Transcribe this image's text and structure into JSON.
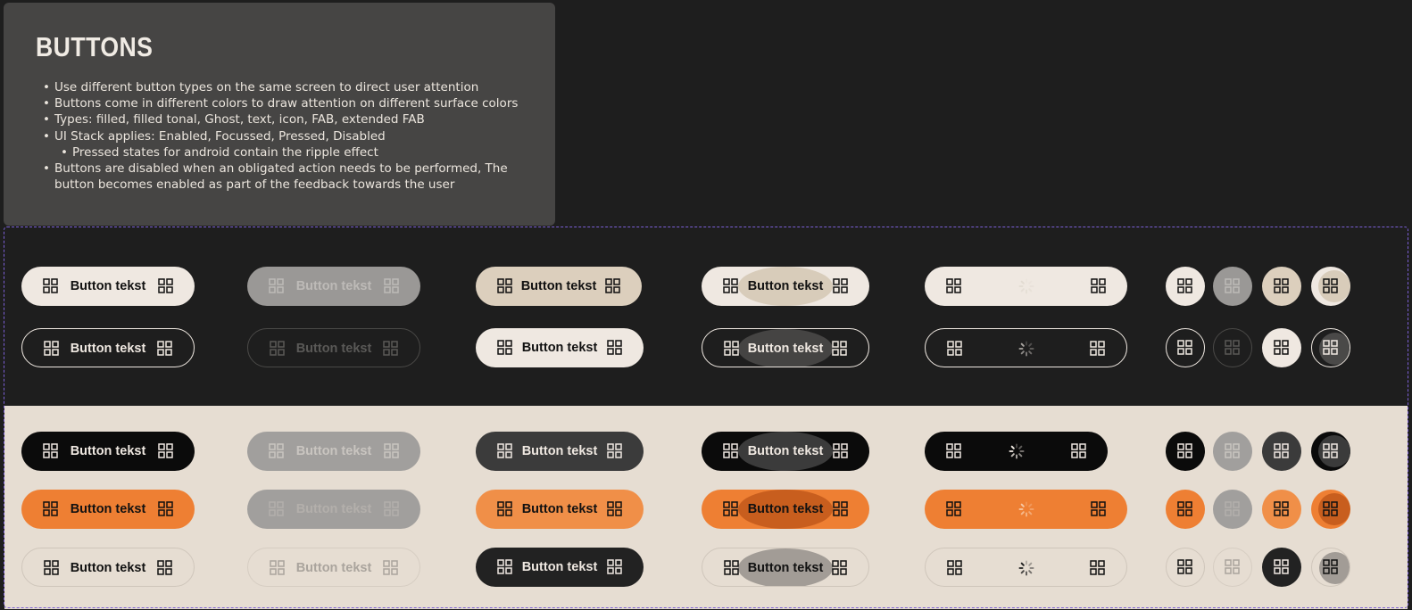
{
  "info": {
    "title": "BUTTONS",
    "bullets": [
      "Use different button types on the same screen to direct user attention",
      "Buttons come in different colors to draw attention on different surface colors",
      "Types: filled, filled tonal, Ghost, text, icon, FAB, extended FAB",
      "UI Stack applies: Enabled, Focussed, Pressed, Disabled",
      "Pressed states for android contain the ripple effect",
      "Buttons are disabled when an obligated action needs to be performed, The button becomes enabled as part of the feedback towards the user"
    ]
  },
  "button_label": "Button tekst",
  "icon_name": "grid-icon",
  "colors": {
    "dark_surface": "#1e1e1e",
    "light_surface": "#e6ddd2",
    "cream": "#efe8e1",
    "beige": "#dccfbd",
    "grey_disabled": "#a19f9d",
    "black": "#0b0b0b",
    "charcoal": "#3b3b3b",
    "orange": "#ee7f33",
    "orange_light": "#f08f48",
    "orange_pressed": "#c85e1e",
    "frame_dash": "#7b5fd6"
  }
}
